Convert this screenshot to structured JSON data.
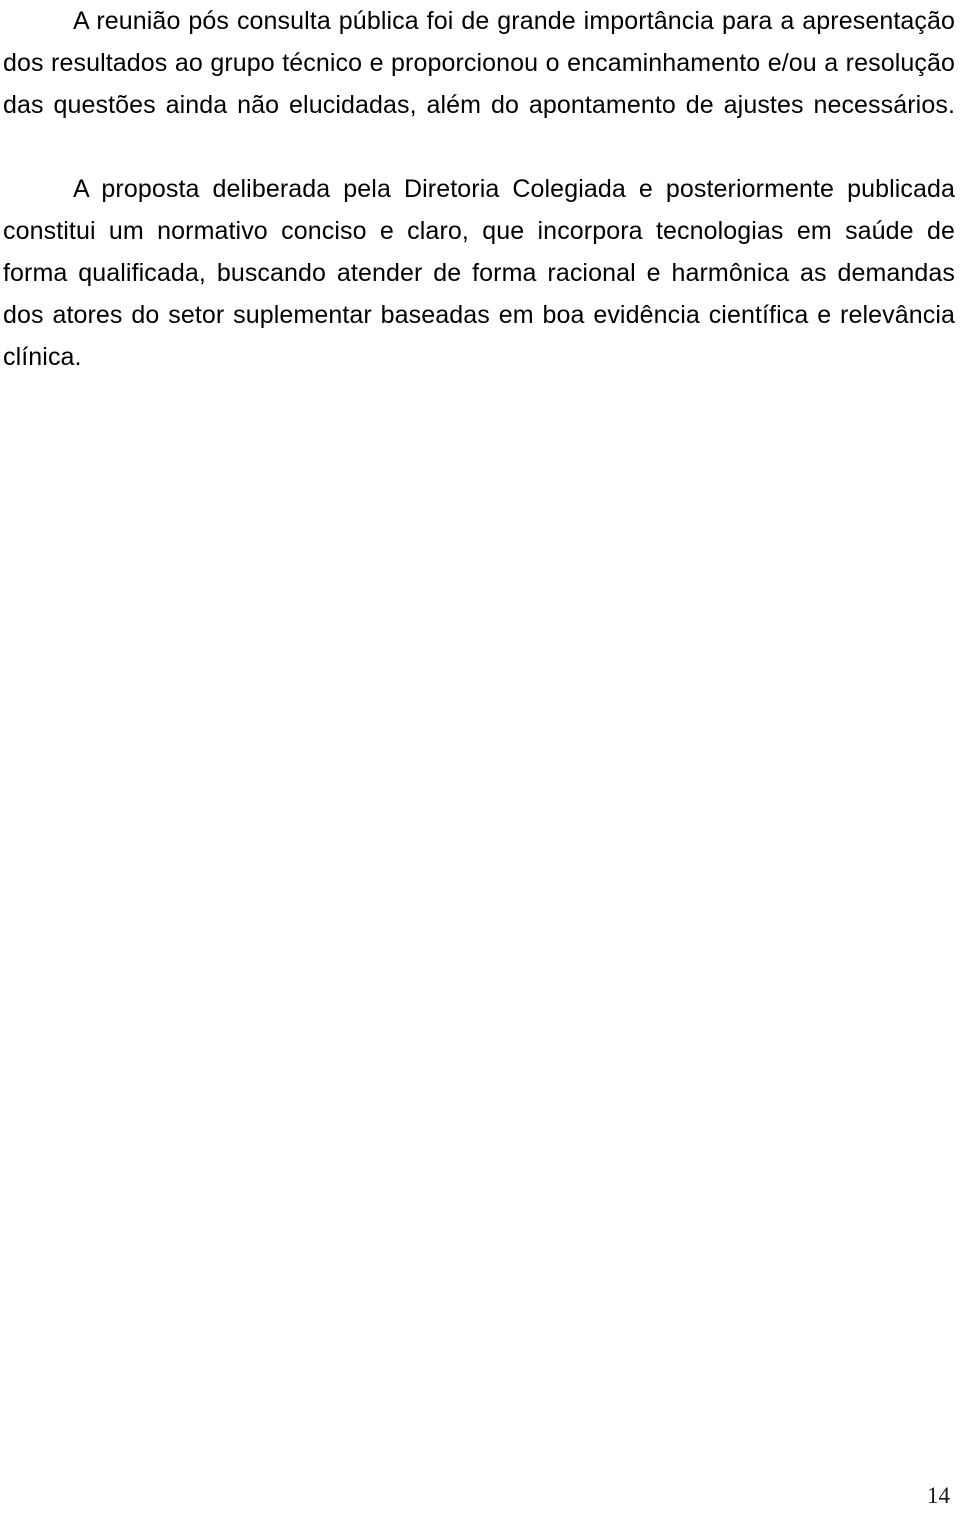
{
  "document": {
    "language": "pt-BR",
    "background_color": "#ffffff",
    "text_color": "#000000",
    "page_number": "14",
    "paragraphs": [
      {
        "id": "paragraph-1",
        "text": "A reunião pós consulta pública foi de grande importância para a apresentação dos resultados ao grupo técnico e proporcionou o encaminhamento e/ou a resolução das questões ainda não elucidadas, além do apontamento de ajustes necessários."
      },
      {
        "id": "paragraph-2",
        "text": "A proposta deliberada pela Diretoria Colegiada e posteriormente publicada constitui um normativo conciso e claro, que incorpora tecnologias em saúde de forma qualificada, buscando atender de forma racional e harmônica as demandas dos atores do setor suplementar baseadas em boa evidência científica e relevância clínica."
      }
    ]
  }
}
